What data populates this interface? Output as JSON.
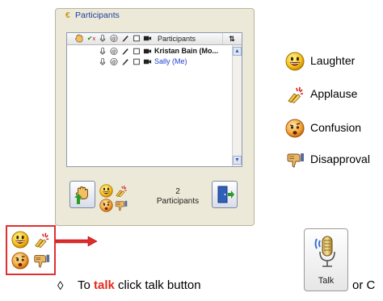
{
  "panel": {
    "title": "Participants",
    "header": {
      "participants_label": "Participants",
      "sort_label": "⇅"
    },
    "participants": [
      {
        "name": "Kristan Bain (Mo...",
        "style": "bold"
      },
      {
        "name": "Sally (Me)",
        "style": "self"
      }
    ],
    "count_value": "2",
    "count_label": "Participants",
    "scroll_up": "▲",
    "scroll_down": "▼"
  },
  "legend": [
    {
      "icon": "laughter-icon",
      "label": "Laughter"
    },
    {
      "icon": "applause-icon",
      "label": "Applause"
    },
    {
      "icon": "confusion-icon",
      "label": "Confusion"
    },
    {
      "icon": "disapproval-icon",
      "label": "Disapproval"
    }
  ],
  "instruction": {
    "bullet": "◊",
    "prefix": "To ",
    "keyword": "talk",
    "middle": " click talk button",
    "tail": "or C"
  },
  "talk_button": {
    "label": "Talk"
  },
  "colors": {
    "accent_red": "#e02b1a",
    "self_name_blue": "#1d3fd0",
    "panel_bg": "#ede9d8"
  }
}
